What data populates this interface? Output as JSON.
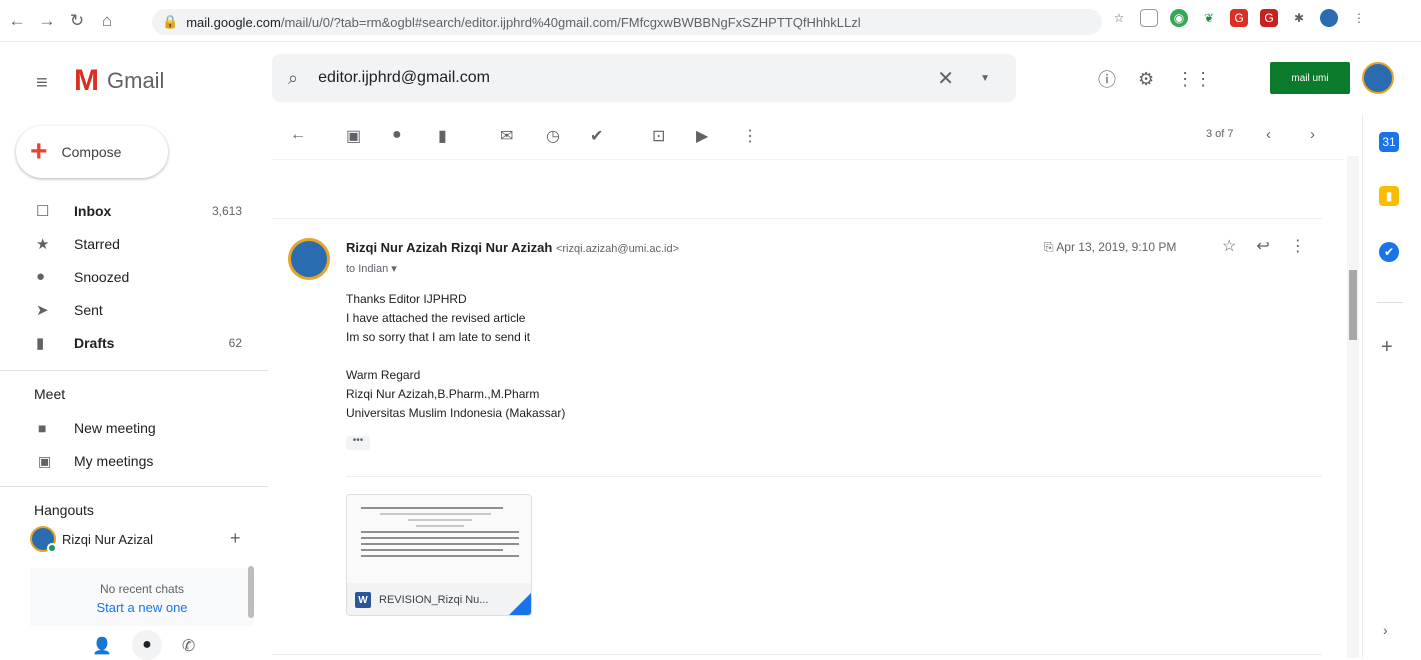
{
  "browser": {
    "url_host": "mail.google.com",
    "url_path": "/mail/u/0/?tab=rm&ogbl#search/editor.ijphrd%40gmail.com/FMfcgxwBWBBNgFxSZHPTTQfHhhkLLzl"
  },
  "app": {
    "name": "Gmail",
    "search_value": "editor.ijphrd@gmail.com",
    "brand_badge_text": "mail umi"
  },
  "sidebar": {
    "compose_label": "Compose",
    "items": [
      {
        "label": "Inbox",
        "count": "3,613",
        "icon": "inbox-icon"
      },
      {
        "label": "Starred",
        "count": "",
        "icon": "star-icon"
      },
      {
        "label": "Snoozed",
        "count": "",
        "icon": "clock-icon"
      },
      {
        "label": "Sent",
        "count": "",
        "icon": "send-icon"
      },
      {
        "label": "Drafts",
        "count": "62",
        "icon": "draft-icon"
      }
    ],
    "meet_title": "Meet",
    "meet_items": [
      {
        "label": "New meeting"
      },
      {
        "label": "My meetings"
      }
    ],
    "hangouts_title": "Hangouts",
    "hangouts_user": "Rizqi Nur Azizal",
    "no_chats": "No recent chats",
    "start_new": "Start a new one"
  },
  "toolbar": {
    "pager": "3 of 7"
  },
  "message": {
    "sender_name": "Rizqi Nur Azizah Rizqi Nur Azizah",
    "sender_email": "<rizqi.azizah@umi.ac.id>",
    "to": "to Indian ▾",
    "date": "Apr 13, 2019, 9:10 PM",
    "body_lines": [
      "Thanks Editor IJPHRD",
      "I have attached the revised article",
      "Im so sorry that I am late to send it",
      "",
      "Warm Regard",
      "Rizqi Nur Azizah,B.Pharm.,M.Pharm",
      "Universitas Muslim Indonesia (Makassar)"
    ],
    "ellipsis": "•••",
    "attachment_name": "REVISION_Rizqi Nu..."
  },
  "colors": {
    "gmail_red": "#d93025",
    "link_blue": "#1a73e8",
    "word_blue": "#2b579a"
  }
}
